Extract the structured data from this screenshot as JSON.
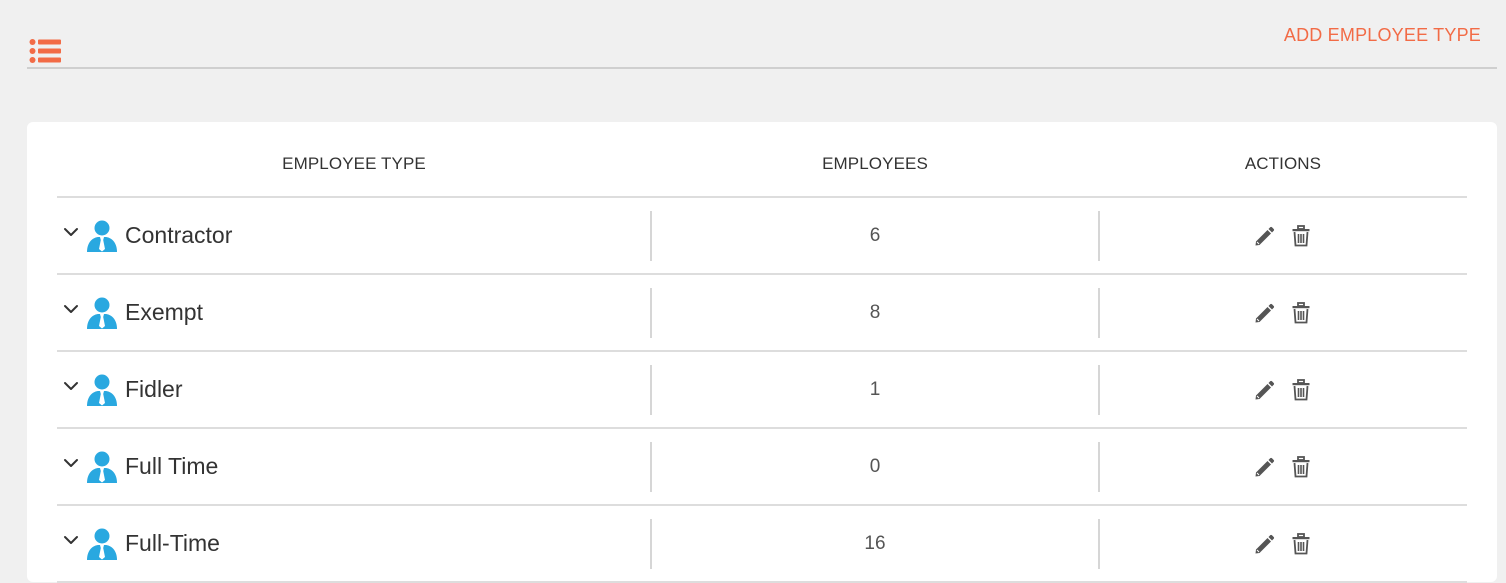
{
  "header": {
    "menu_icon": "list-icon",
    "add_label": "ADD EMPLOYEE TYPE",
    "accent_color": "#f26b46"
  },
  "table": {
    "columns": [
      "EMPLOYEE TYPE",
      "EMPLOYEES",
      "ACTIONS"
    ],
    "rows": [
      {
        "name": "Contractor",
        "employees": "6"
      },
      {
        "name": "Exempt",
        "employees": "8"
      },
      {
        "name": "Fidler",
        "employees": "1"
      },
      {
        "name": "Full Time",
        "employees": "0"
      },
      {
        "name": "Full-Time",
        "employees": "16"
      }
    ],
    "row_icon": "person-icon",
    "action_icons": [
      "edit-icon",
      "trash-icon"
    ],
    "icon_color": "#29a8e0"
  }
}
